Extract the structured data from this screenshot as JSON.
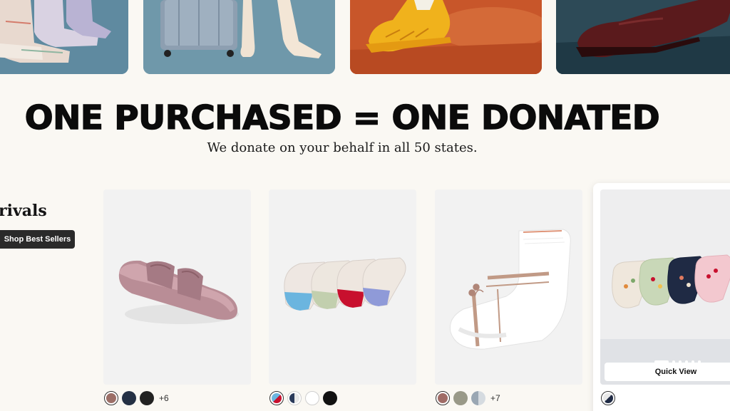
{
  "hero": {
    "tiles": [
      {
        "icon": "ankle-socks-photo"
      },
      {
        "icon": "luggage-and-feet-photo"
      },
      {
        "icon": "yellow-sneaker-photo"
      },
      {
        "icon": "burgundy-loafer-photo"
      }
    ]
  },
  "headline": "ONE PURCHASED = ONE DONATED",
  "subheadline": "We donate on your behalf in all 50 states.",
  "section": {
    "title": "rivals",
    "cta_label": "Shop Best Sellers"
  },
  "products": [
    {
      "image": "pink-slide-sandal-image",
      "swatches": [
        "#9c6f67",
        "#243044",
        "#222222"
      ],
      "more": "+6"
    },
    {
      "image": "no-show-socks-4-pack-image",
      "swatches": [
        "split",
        "split-dark",
        "#ffffff",
        "#111111"
      ],
      "more": ""
    },
    {
      "image": "white-ankle-sock-image",
      "swatches": [
        "#a06c66",
        "#999988",
        "split-grey"
      ],
      "more": "+7"
    },
    {
      "image": "floral-ankle-socks-4-pack-image",
      "swatches": [
        "split-navy"
      ],
      "more": "",
      "quick_view_label": "Quick View"
    }
  ],
  "colors": {
    "background": "#faf8f3",
    "button": "#2a2a2a",
    "card": "#f2f2f2"
  }
}
